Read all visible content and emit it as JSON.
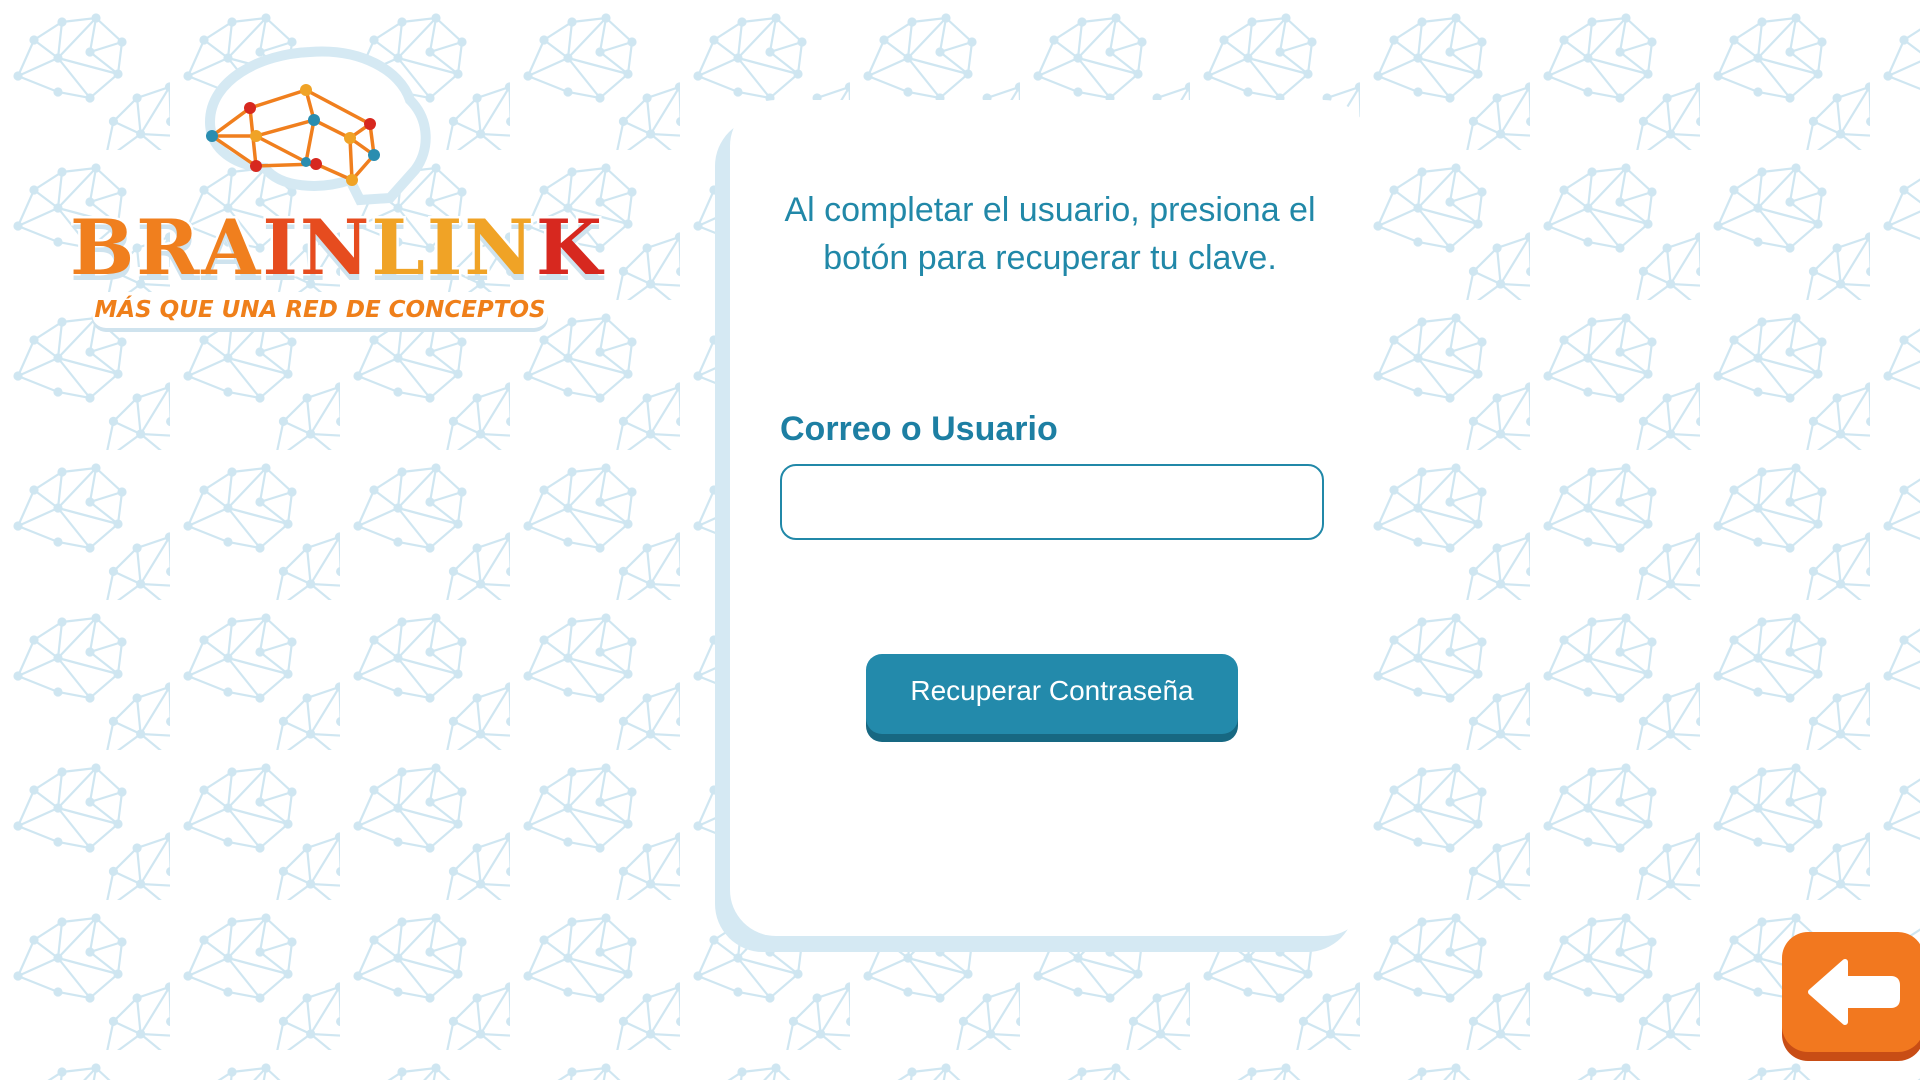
{
  "logo": {
    "title_part1": "BRA",
    "title_part2": "IN",
    "title_part3": "LIN",
    "title_part4": "K",
    "subtitle": "MÁS QUE UNA RED DE CONCEPTOS"
  },
  "form": {
    "instructions": "Al completar el usuario, presiona el botón para recuperar tu clave.",
    "field_label": "Correo o Usuario",
    "field_value": "",
    "field_placeholder": "",
    "submit_label": "Recuperar Contraseña"
  },
  "navigation": {
    "back_icon": "arrow-left-icon"
  },
  "colors": {
    "accent_blue": "#238aab",
    "text_blue": "#2188a8",
    "orange": "#f2781f",
    "pattern": "#cfe6f1"
  }
}
